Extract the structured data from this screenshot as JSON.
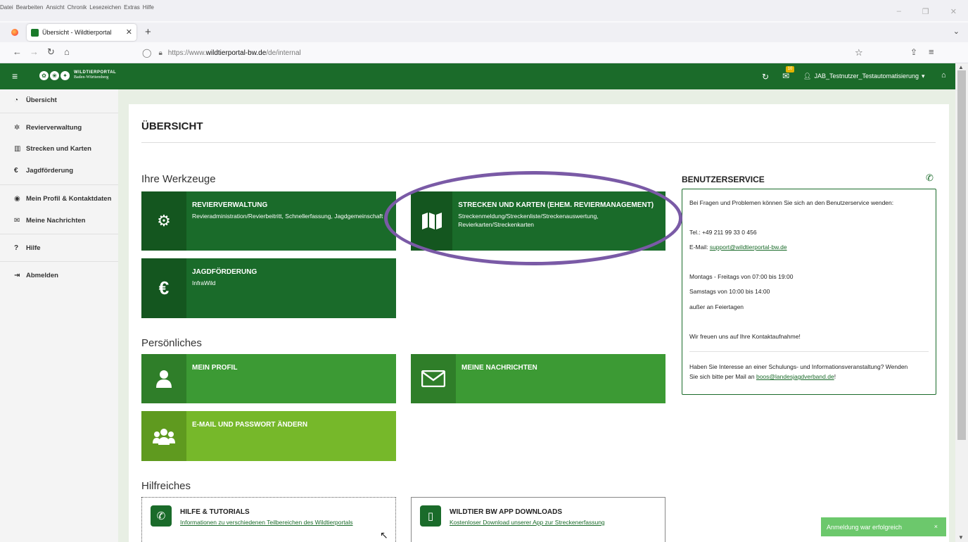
{
  "browser": {
    "menu": [
      "Datei",
      "Bearbeiten",
      "Ansicht",
      "Chronik",
      "Lesezeichen",
      "Extras",
      "Hilfe"
    ],
    "tab_title": "Übersicht - Wildtierportal",
    "url_prefix": "https://www.",
    "url_host": "wildtierportal-bw.de",
    "url_path": "/de/internal"
  },
  "header": {
    "logo_line1": "WILDTIERPORTAL",
    "logo_line2": "Baden-Württemberg",
    "mail_count": "10",
    "user": "JAB_Testnutzer_Testautomatisierung"
  },
  "sidebar": {
    "items": [
      {
        "label": "Übersicht",
        "icon": "tachometer-icon"
      },
      {
        "label": "Revierverwaltung",
        "icon": "gear-icon"
      },
      {
        "label": "Strecken und Karten",
        "icon": "map-icon"
      },
      {
        "label": "Jagdförderung",
        "icon": "euro-icon"
      },
      {
        "label": "Mein Profil & Kontaktdaten",
        "icon": "user-circle-icon"
      },
      {
        "label": "Meine Nachrichten",
        "icon": "envelope-icon"
      },
      {
        "label": "Hilfe",
        "icon": "question-icon"
      },
      {
        "label": "Abmelden",
        "icon": "sign-out-icon"
      }
    ]
  },
  "main": {
    "title": "ÜBERSICHT",
    "sections": {
      "werkzeuge": "Ihre Werkzeuge",
      "persoenliches": "Persönliches",
      "hilfreiches": "Hilfreiches"
    },
    "tiles": {
      "revierverwaltung": {
        "title": "REVIERVERWALTUNG",
        "sub": "Revieradministration/Revierbeitritt, Schnellerfassung, Jagdgemeinschaft"
      },
      "strecken": {
        "title": "STRECKEN UND KARTEN (EHEM. REVIERMANAGEMENT)",
        "sub": "Streckenmeldung/Streckenliste/Streckenauswertung, Revierkarten/Streckenkarten"
      },
      "jagdfoerderung": {
        "title": "JAGDFÖRDERUNG",
        "sub": "InfraWild"
      },
      "profil": {
        "title": "MEIN PROFIL"
      },
      "nachrichten": {
        "title": "MEINE NACHRICHTEN"
      },
      "passwort": {
        "title": "E-MAIL UND PASSWORT ÄNDERN"
      }
    },
    "help": {
      "tutorials": {
        "title": "HILFE & TUTORIALS",
        "link": "Informationen zu verschiedenen Teilbereichen des Wildtierportals"
      },
      "app": {
        "title": "WILDTIER BW APP DOWNLOADS",
        "link": "Kostenloser Download unserer App zur Streckenerfassung"
      }
    }
  },
  "service": {
    "title": "BENUTZERSERVICE",
    "intro": "Bei Fragen und Problemen können Sie sich an den Benutzerservice wenden:",
    "tel": "Tel.: +49 211 99 33 0 456",
    "email_label": "E-Mail: ",
    "email": "support@wildtierportal-bw.de",
    "hours1": "Montags - Freitags von 07:00 bis 19:00",
    "hours2": "Samstags von 10:00 bis 14:00",
    "hours3": "außer an Feiertagen",
    "closing": "Wir freuen uns auf Ihre Kontaktaufnahme!",
    "schulung1": "Haben Sie Interesse an einer Schulungs- und Informationsveranstaltung? Wenden",
    "schulung2_pre": "Sie sich bitte per Mail an ",
    "schulung_email": "boos@landesjagdverband.de",
    "schulung2_post": "!"
  },
  "toast": {
    "text": "Anmeldung war erfolgreich",
    "close": "×"
  },
  "colors": {
    "brand": "#1b6b2a",
    "mid_green": "#3c9a34",
    "lime": "#76b82a",
    "annotation": "#7a5aa6"
  }
}
